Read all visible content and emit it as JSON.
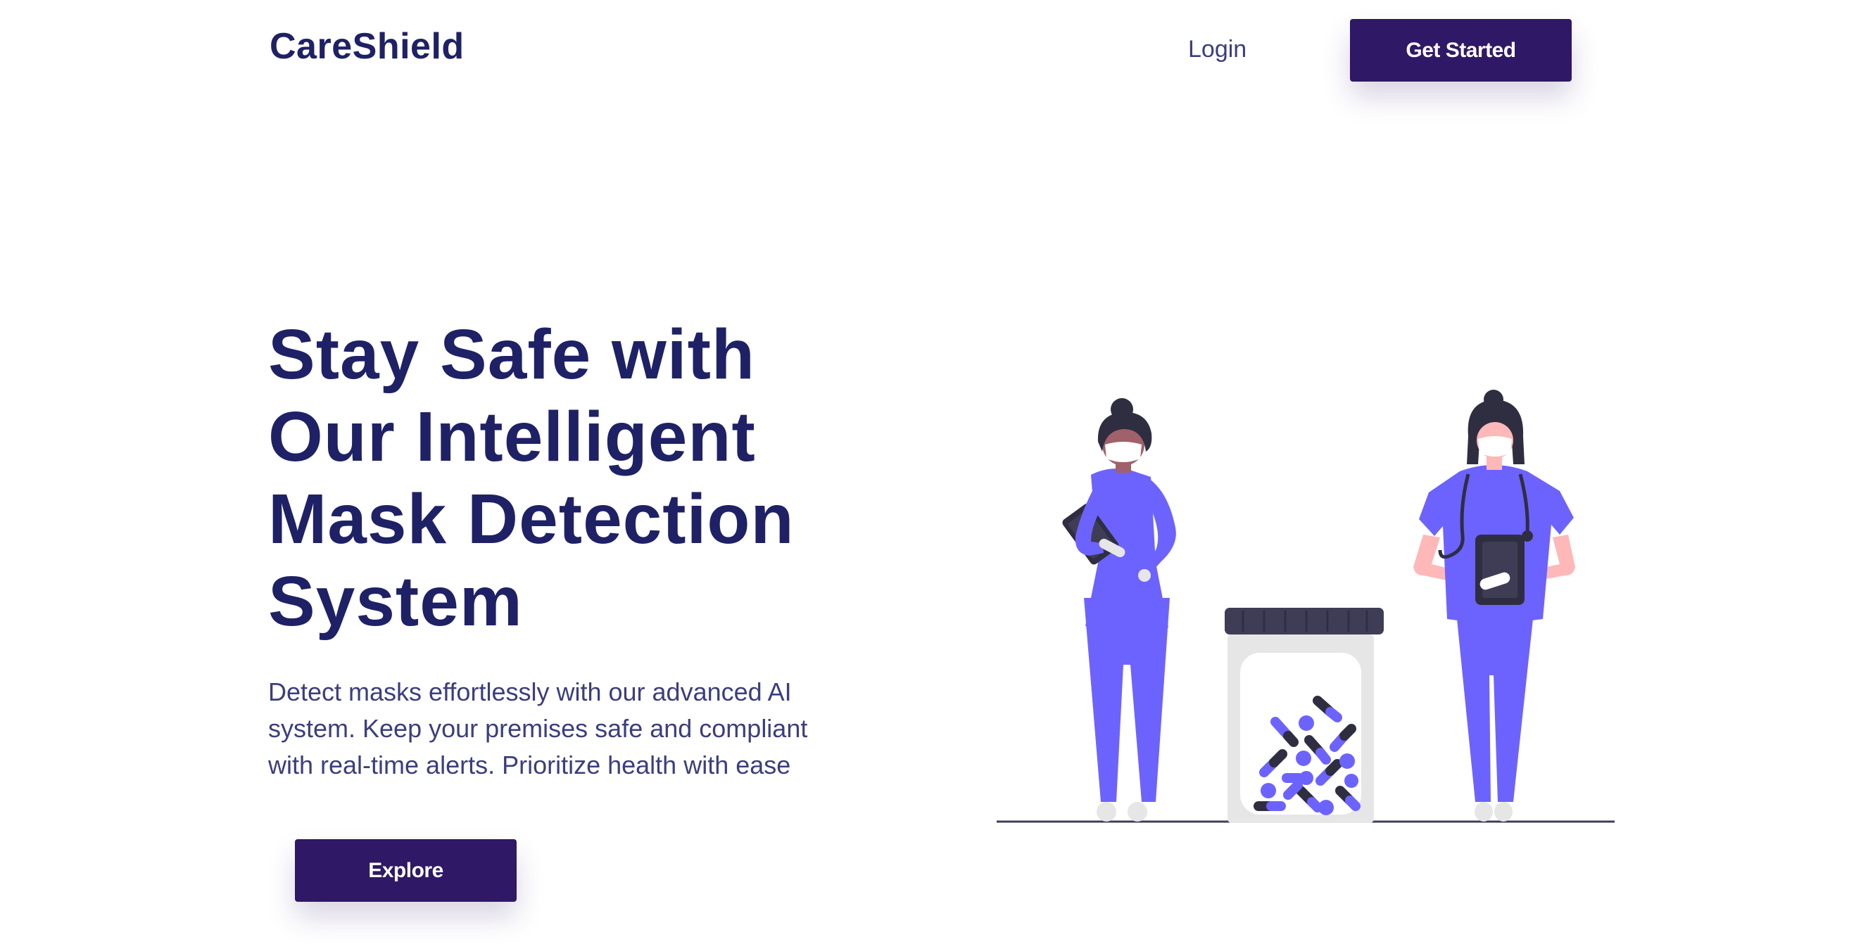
{
  "header": {
    "logo": "CareShield",
    "login_label": "Login",
    "get_started_label": "Get Started"
  },
  "hero": {
    "title_lines": [
      "Stay Safe with",
      "Our Intelligent",
      "Mask Detection",
      "System"
    ],
    "subtitle_lines": [
      "Detect masks effortlessly with our advanced AI",
      "system. Keep your premises safe and compliant",
      "with real-time alerts. Prioritize health with ease"
    ],
    "explore_label": "Explore"
  },
  "colors": {
    "brand_navy": "#1f2166",
    "button_purple": "#2f1865",
    "scrubs_violet": "#6c63ff",
    "hair_dark": "#2f2e41",
    "text_muted": "#3b3e7d"
  },
  "illustration": {
    "icons": [
      "health-worker-with-tablet",
      "health-worker-with-stethoscope",
      "pill-jar"
    ]
  }
}
